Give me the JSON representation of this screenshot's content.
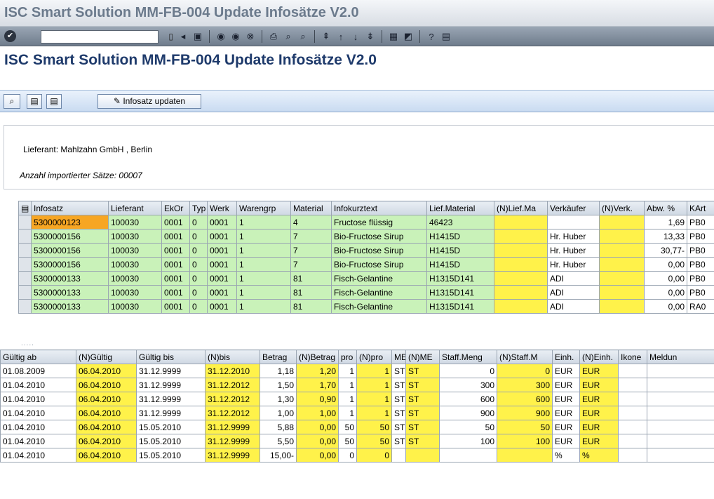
{
  "window": {
    "title": "ISC Smart Solution MM-FB-004 Update Infosätze V2.0"
  },
  "toolbar": {
    "command_value": ""
  },
  "page": {
    "title": "ISC Smart Solution MM-FB-004 Update Infosätze V2.0"
  },
  "appbar": {
    "update_label": "Infosatz updaten"
  },
  "info": {
    "lieferant": "Lieferant: Mahlzahn GmbH , Berlin",
    "anzahl": "Anzahl importierter Sätze: 00007"
  },
  "table1": {
    "headers": [
      "Infosatz",
      "Lieferant",
      "EkOr",
      "Typ",
      "Werk",
      "Warengrp",
      "Material",
      "Infokurztext",
      "Lief.Material",
      "(N)Lief.Ma",
      "Verkäufer",
      "(N)Verk.",
      "Abw. %",
      "KArt"
    ],
    "rows": [
      [
        "5300000123",
        "100030",
        "0001",
        "0",
        "0001",
        "1",
        "4",
        "Fructose flüssig",
        "46423",
        "",
        "",
        "",
        "1,69",
        "PB0"
      ],
      [
        "5300000156",
        "100030",
        "0001",
        "0",
        "0001",
        "1",
        "7",
        "Bio-Fructose Sirup",
        "H1415D",
        "",
        "Hr. Huber",
        "",
        "13,33",
        "PB0"
      ],
      [
        "5300000156",
        "100030",
        "0001",
        "0",
        "0001",
        "1",
        "7",
        "Bio-Fructose Sirup",
        "H1415D",
        "",
        "Hr. Huber",
        "",
        "30,77-",
        "PB0"
      ],
      [
        "5300000156",
        "100030",
        "0001",
        "0",
        "0001",
        "1",
        "7",
        "Bio-Fructose Sirup",
        "H1415D",
        "",
        "Hr. Huber",
        "",
        "0,00",
        "PB0"
      ],
      [
        "5300000133",
        "100030",
        "0001",
        "0",
        "0001",
        "1",
        "81",
        "Fisch-Gelantine",
        "H1315D141",
        "",
        "ADI",
        "",
        "0,00",
        "PB0"
      ],
      [
        "5300000133",
        "100030",
        "0001",
        "0",
        "0001",
        "1",
        "81",
        "Fisch-Gelantine",
        "H1315D141",
        "",
        "ADI",
        "",
        "0,00",
        "PB0"
      ],
      [
        "5300000133",
        "100030",
        "0001",
        "0",
        "0001",
        "1",
        "81",
        "Fisch-Gelantine",
        "H1315D141",
        "",
        "ADI",
        "",
        "0,00",
        "RA0"
      ]
    ]
  },
  "table2": {
    "headers": [
      "Gültig ab",
      "(N)Gültig",
      "Gültig bis",
      "(N)bis",
      "Betrag",
      "(N)Betrag",
      "pro",
      "(N)pro",
      "ME",
      "(N)ME",
      "Staff.Meng",
      "(N)Staff.M",
      "Einh.",
      "(N)Einh.",
      "Ikone",
      "Meldun"
    ],
    "rows": [
      [
        "01.08.2009",
        "06.04.2010",
        "31.12.9999",
        "31.12.2010",
        "1,18",
        "1,20",
        "1",
        "1",
        "ST",
        "ST",
        "0",
        "0",
        "EUR",
        "EUR",
        "",
        ""
      ],
      [
        "01.04.2010",
        "06.04.2010",
        "31.12.9999",
        "31.12.2012",
        "1,50",
        "1,70",
        "1",
        "1",
        "ST",
        "ST",
        "300",
        "300",
        "EUR",
        "EUR",
        "",
        ""
      ],
      [
        "01.04.2010",
        "06.04.2010",
        "31.12.9999",
        "31.12.2012",
        "1,30",
        "0,90",
        "1",
        "1",
        "ST",
        "ST",
        "600",
        "600",
        "EUR",
        "EUR",
        "",
        ""
      ],
      [
        "01.04.2010",
        "06.04.2010",
        "31.12.9999",
        "31.12.2012",
        "1,00",
        "1,00",
        "1",
        "1",
        "ST",
        "ST",
        "900",
        "900",
        "EUR",
        "EUR",
        "",
        ""
      ],
      [
        "01.04.2010",
        "06.04.2010",
        "15.05.2010",
        "31.12.9999",
        "5,88",
        "0,00",
        "50",
        "50",
        "ST",
        "ST",
        "50",
        "50",
        "EUR",
        "EUR",
        "",
        ""
      ],
      [
        "01.04.2010",
        "06.04.2010",
        "15.05.2010",
        "31.12.9999",
        "5,50",
        "0,00",
        "50",
        "50",
        "ST",
        "ST",
        "100",
        "100",
        "EUR",
        "EUR",
        "",
        ""
      ],
      [
        "01.04.2010",
        "06.04.2010",
        "15.05.2010",
        "31.12.9999",
        "15,00-",
        "0,00",
        "0",
        "0",
        "",
        "",
        "",
        "",
        "%",
        "%",
        "",
        ""
      ]
    ]
  }
}
